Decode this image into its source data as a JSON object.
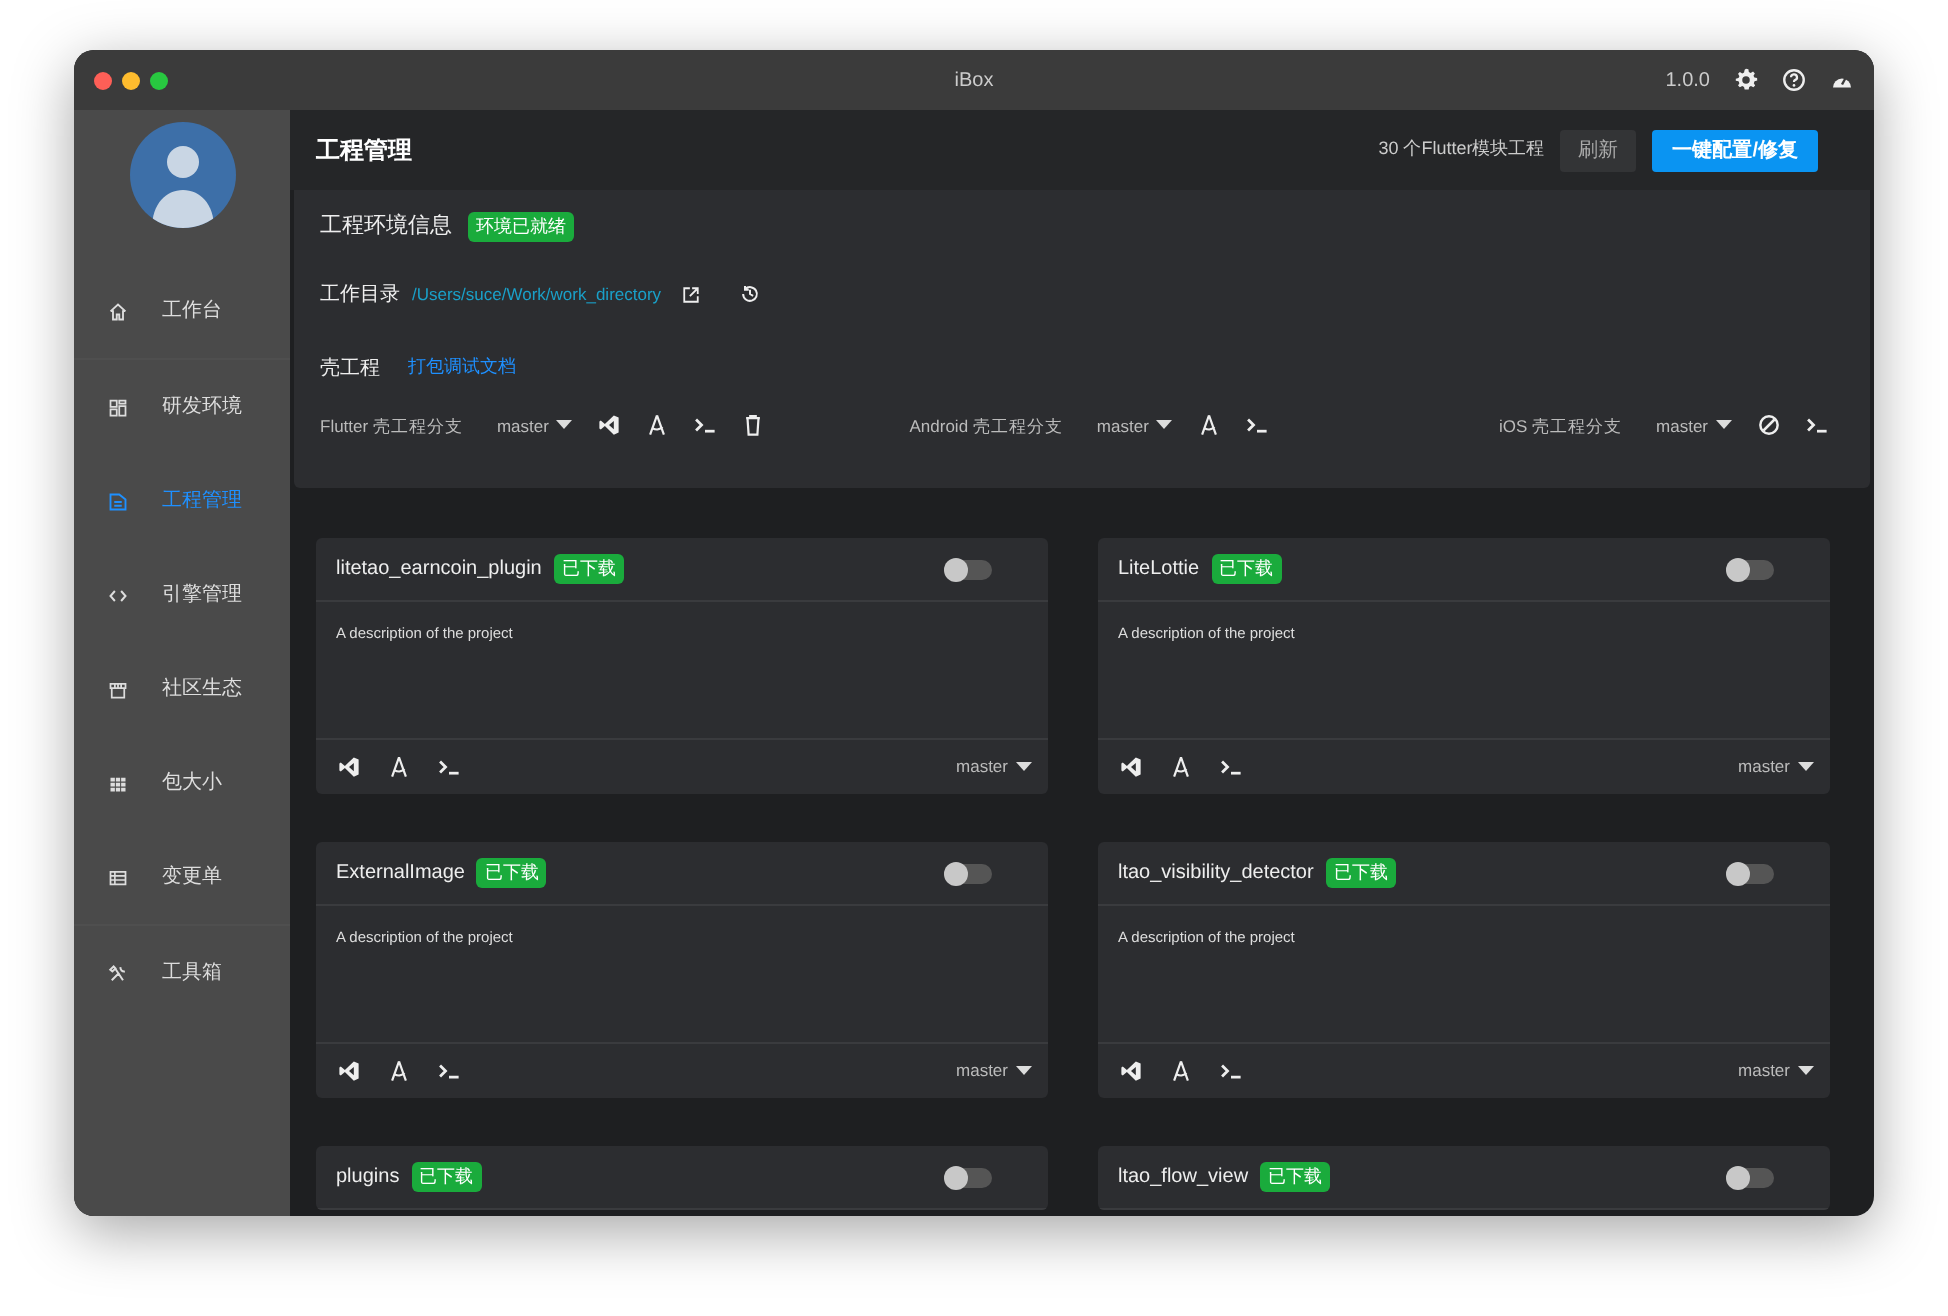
{
  "window": {
    "title": "iBox",
    "version": "1.0.0"
  },
  "sidebar": {
    "items": [
      {
        "label": "工作台",
        "selected": false
      },
      {
        "label": "研发环境",
        "selected": false
      },
      {
        "label": "工程管理",
        "selected": true
      },
      {
        "label": "引擎管理",
        "selected": false
      },
      {
        "label": "社区生态",
        "selected": false
      },
      {
        "label": "包大小",
        "selected": false
      },
      {
        "label": "变更单",
        "selected": false
      },
      {
        "label": "工具箱",
        "selected": false
      }
    ]
  },
  "header": {
    "title": "工程管理",
    "count": "30 个Flutter模块工程",
    "buttons": [
      {
        "label": "刷新",
        "kind": "secondary"
      },
      {
        "label": "一键配置/修复",
        "kind": "primary"
      }
    ]
  },
  "environment": {
    "title": "工程环境信息",
    "status": "环境已就绪",
    "workdir_label": "工作目录",
    "workdir": "/Users/suce/Work/work_directory",
    "shell_title": "壳工程",
    "doc_link": "打包调试文档",
    "branches": [
      {
        "label": "Flutter 壳工程分支",
        "branch": "master",
        "tools": [
          {
            "kind": "vscode"
          },
          {
            "kind": "xcode"
          },
          {
            "kind": "terminal"
          },
          {
            "kind": "delete"
          }
        ]
      },
      {
        "label": "Android 壳工程分支",
        "branch": "master",
        "tools": [
          {
            "kind": "xcode"
          },
          {
            "kind": "terminal"
          }
        ]
      },
      {
        "label": "iOS 壳工程分支",
        "branch": "master",
        "tools": [
          {
            "kind": "safari"
          },
          {
            "kind": "terminal"
          }
        ]
      }
    ]
  },
  "projects": [
    {
      "name": "litetao_earncoin_plugin",
      "badge": "已下载",
      "on": false,
      "description": "A description of the project",
      "branch": "master",
      "tools": [
        {
          "kind": "vscode"
        },
        {
          "kind": "xcode"
        },
        {
          "kind": "terminal"
        }
      ]
    },
    {
      "name": "LiteLottie",
      "badge": "已下载",
      "on": false,
      "description": "A description of the project",
      "branch": "master",
      "tools": [
        {
          "kind": "vscode"
        },
        {
          "kind": "xcode"
        },
        {
          "kind": "terminal"
        }
      ]
    },
    {
      "name": "ExternalImage",
      "badge": "已下载",
      "on": false,
      "description": "A description of the project",
      "branch": "master",
      "tools": [
        {
          "kind": "vscode"
        },
        {
          "kind": "xcode"
        },
        {
          "kind": "terminal"
        }
      ]
    },
    {
      "name": "ltao_visibility_detector",
      "badge": "已下载",
      "on": false,
      "description": "A description of the project",
      "branch": "master",
      "tools": [
        {
          "kind": "vscode"
        },
        {
          "kind": "xcode"
        },
        {
          "kind": "terminal"
        }
      ]
    },
    {
      "name": "plugins",
      "badge": "已下载",
      "on": false
    },
    {
      "name": "ltao_flow_view",
      "badge": "已下载",
      "on": false
    }
  ]
}
